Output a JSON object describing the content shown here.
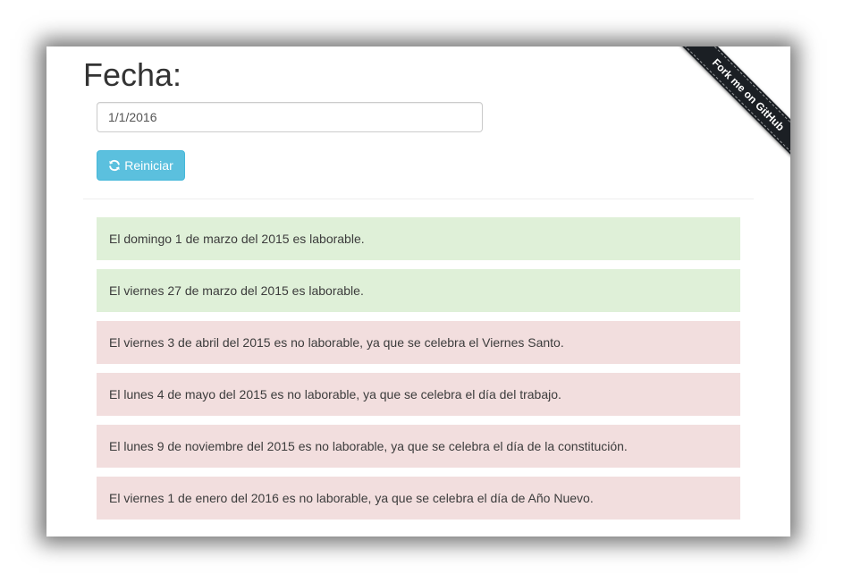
{
  "header": {
    "title": "Fecha:"
  },
  "form": {
    "date_value": "1/1/2016",
    "reset_label": "Reiniciar",
    "reset_icon": "refresh-icon"
  },
  "ribbon": {
    "label": "Fork me on GitHub"
  },
  "results": [
    {
      "status": "success",
      "text": "El domingo 1 de marzo del 2015 es laborable."
    },
    {
      "status": "success",
      "text": "El viernes 27 de marzo del 2015 es laborable."
    },
    {
      "status": "danger",
      "text": "El viernes 3 de abril del 2015 es no laborable, ya que se celebra el Viernes Santo."
    },
    {
      "status": "danger",
      "text": "El lunes 4 de mayo del 2015 es no laborable, ya que se celebra el día del trabajo."
    },
    {
      "status": "danger",
      "text": "El lunes 9 de noviembre del 2015 es no laborable, ya que se celebra el día de la constitución."
    },
    {
      "status": "danger",
      "text": "El viernes 1 de enero del 2016 es no laborable, ya que se celebra el día de Año Nuevo."
    }
  ],
  "colors": {
    "success_bg": "#dff0d8",
    "danger_bg": "#f2dede",
    "info_button": "#5bc0de",
    "ribbon": "#1b1f24"
  }
}
